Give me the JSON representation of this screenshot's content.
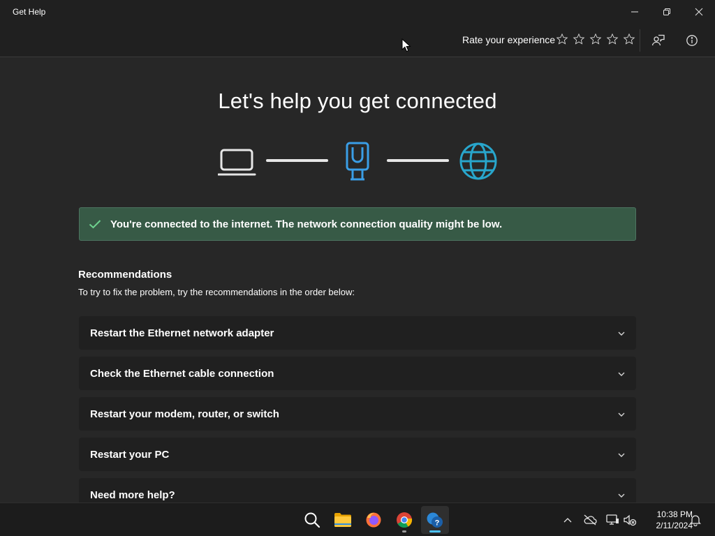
{
  "window": {
    "title": "Get Help",
    "controls": [
      "minimize-icon",
      "restore-icon",
      "close-icon"
    ]
  },
  "header": {
    "rate_label": "Rate your experience",
    "star_count": 5,
    "rating": 0,
    "buttons": [
      "feedback-icon",
      "info-icon"
    ]
  },
  "main": {
    "title": "Let's help you get connected",
    "diagram": {
      "nodes": [
        "laptop-icon",
        "ethernet-icon",
        "globe-icon"
      ],
      "colors": {
        "device": "#e6e6e6",
        "adapter": "#3a9ee6",
        "internet": "#28a6cc"
      }
    },
    "banner": {
      "status": "success",
      "icon": "checkmark-icon",
      "message": "You're connected to the internet. The network connection quality might be low.",
      "color": "#375a46"
    },
    "recommendations": {
      "heading": "Recommendations",
      "subtext": "To try to fix the problem, try the recommendations in the order below:",
      "items": [
        {
          "label": "Restart the Ethernet network adapter"
        },
        {
          "label": "Check the Ethernet cable connection"
        },
        {
          "label": "Restart your modem, router, or switch"
        },
        {
          "label": "Restart your PC"
        },
        {
          "label": "Need more help?"
        }
      ]
    }
  },
  "taskbar": {
    "apps": [
      "search-icon",
      "file-explorer-icon",
      "firefox-icon",
      "chrome-icon",
      "get-help-icon"
    ],
    "active_app": "get-help-icon",
    "tray": [
      "chevron-up-icon",
      "onedrive-icon",
      "network-icon",
      "volume-muted-icon"
    ],
    "time": "10:38 PM",
    "date": "2/11/2024",
    "notification_icon": "bell-icon"
  }
}
